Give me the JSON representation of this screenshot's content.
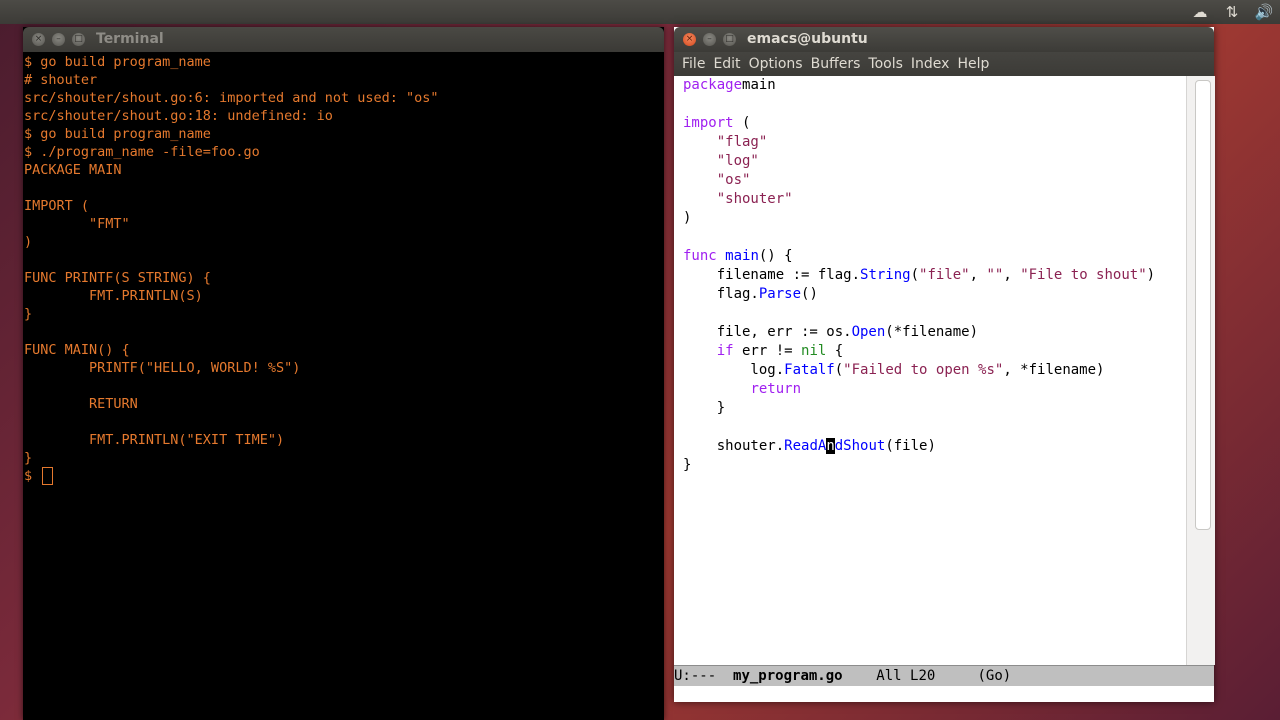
{
  "top_panel": {
    "icons": [
      "cloud-icon",
      "network-icon",
      "sound-icon"
    ]
  },
  "terminal": {
    "title": "Terminal",
    "lines": [
      "$ go build program_name",
      "# shouter",
      "src/shouter/shout.go:6: imported and not used: \"os\"",
      "src/shouter/shout.go:18: undefined: io",
      "$ go build program_name",
      "$ ./program_name -file=foo.go",
      "PACKAGE MAIN",
      "",
      "IMPORT (",
      "        \"FMT\"",
      ")",
      "",
      "FUNC PRINTF(S STRING) {",
      "        FMT.PRINTLN(S)",
      "}",
      "",
      "FUNC MAIN() {",
      "        PRINTF(\"HELLO, WORLD! %S\")",
      "",
      "        RETURN",
      "",
      "        FMT.PRINTLN(\"EXIT TIME\")",
      "}"
    ],
    "prompt": "$ "
  },
  "emacs": {
    "title": "emacs@ubuntu",
    "menu": [
      "File",
      "Edit",
      "Options",
      "Buffers",
      "Tools",
      "Index",
      "Help"
    ],
    "code_lines": [
      [
        [
          "kw",
          "package"
        ],
        [
          "",
          "main"
        ]
      ],
      [],
      [
        [
          "kw",
          "import"
        ],
        [
          "",
          " ("
        ]
      ],
      [
        [
          "",
          "    "
        ],
        [
          "str",
          "\"flag\""
        ]
      ],
      [
        [
          "",
          "    "
        ],
        [
          "str",
          "\"log\""
        ]
      ],
      [
        [
          "",
          "    "
        ],
        [
          "str",
          "\"os\""
        ]
      ],
      [
        [
          "",
          "    "
        ],
        [
          "str",
          "\"shouter\""
        ]
      ],
      [
        [
          "",
          ")"
        ]
      ],
      [],
      [
        [
          "kw",
          "func"
        ],
        [
          "",
          " "
        ],
        [
          "fn",
          "main"
        ],
        [
          "",
          "() {"
        ]
      ],
      [
        [
          "",
          "    filename := flag."
        ],
        [
          "fn",
          "String"
        ],
        [
          "",
          "("
        ],
        [
          "str",
          "\"file\""
        ],
        [
          "",
          ", "
        ],
        [
          "str",
          "\"\""
        ],
        [
          "",
          ", "
        ],
        [
          "str",
          "\"File to shout\""
        ],
        [
          "",
          ")"
        ]
      ],
      [
        [
          "",
          "    flag."
        ],
        [
          "fn",
          "Parse"
        ],
        [
          "",
          "()"
        ]
      ],
      [],
      [
        [
          "",
          "    file, err := os."
        ],
        [
          "fn",
          "Open"
        ],
        [
          "",
          "(*filename)"
        ]
      ],
      [
        [
          "",
          "    "
        ],
        [
          "kw",
          "if"
        ],
        [
          "",
          " err != "
        ],
        [
          "bi",
          "nil"
        ],
        [
          "",
          " {"
        ]
      ],
      [
        [
          "",
          "        log."
        ],
        [
          "fn",
          "Fatalf"
        ],
        [
          "",
          "("
        ],
        [
          "str",
          "\"Failed to open %s\""
        ],
        [
          "",
          ", *filename)"
        ]
      ],
      [
        [
          "",
          "        "
        ],
        [
          "kw",
          "return"
        ]
      ],
      [
        [
          "",
          "    }"
        ]
      ],
      [],
      [
        [
          "",
          "    shouter."
        ],
        [
          "fn",
          "ReadA"
        ],
        [
          "cur",
          "n"
        ],
        [
          "fn",
          "dShout"
        ],
        [
          "",
          "(file)"
        ]
      ],
      [
        [
          "",
          "}"
        ]
      ]
    ],
    "modeline": {
      "status": "U:---  ",
      "buffer": "my_program.go",
      "position": "    All L20",
      "mode": "     (Go)"
    }
  }
}
